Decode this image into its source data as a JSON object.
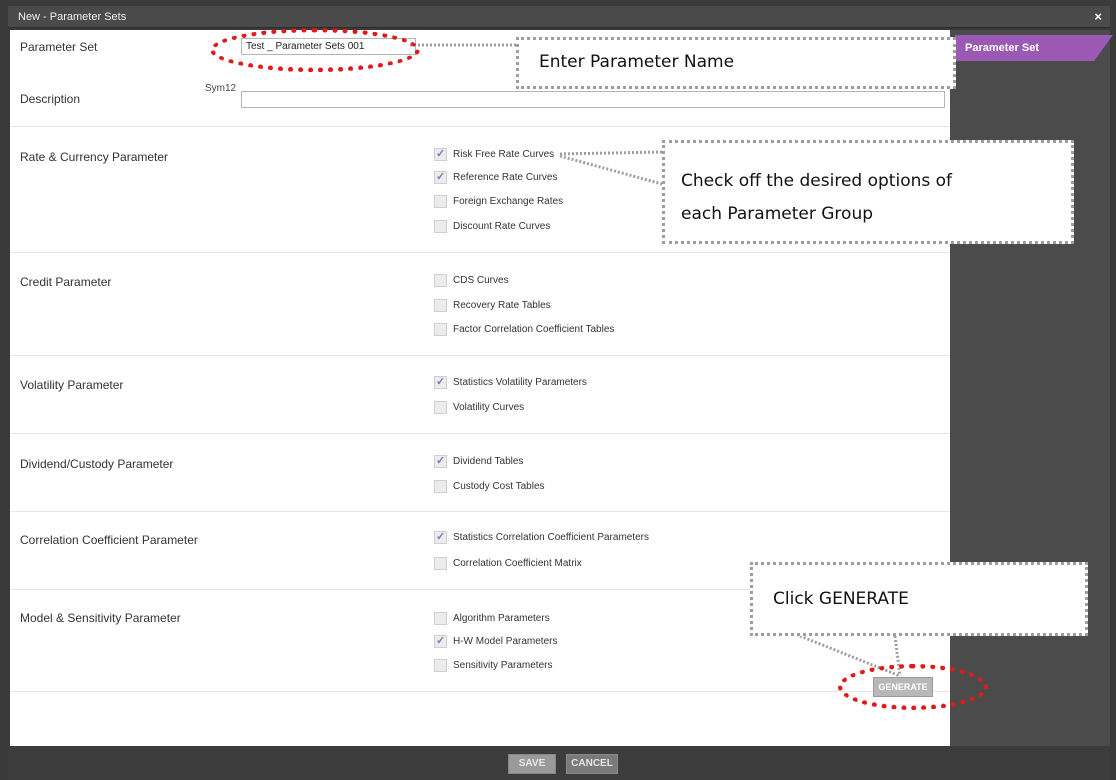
{
  "window": {
    "title": "New - Parameter Sets",
    "close_glyph": "×"
  },
  "side_tab": {
    "label": "Parameter Set",
    "color": "#9b59b6"
  },
  "form": {
    "parameter_set_label": "Parameter Set",
    "parameter_set_value": "Test _ Parameter Sets 001",
    "sym_hint": "Sym12",
    "description_label": "Description",
    "description_value": ""
  },
  "groups": [
    {
      "label": "Rate & Currency Parameter",
      "options": [
        {
          "label": "Risk Free Rate Curves",
          "checked": true
        },
        {
          "label": "Reference Rate Curves",
          "checked": true
        },
        {
          "label": "Foreign Exchange Rates",
          "checked": false
        },
        {
          "label": "Discount Rate Curves",
          "checked": false
        }
      ]
    },
    {
      "label": "Credit Parameter",
      "options": [
        {
          "label": "CDS Curves",
          "checked": false
        },
        {
          "label": "Recovery Rate Tables",
          "checked": false
        },
        {
          "label": "Factor Correlation Coefficient Tables",
          "checked": false
        }
      ]
    },
    {
      "label": "Volatility Parameter",
      "options": [
        {
          "label": "Statistics Volatility Parameters",
          "checked": true
        },
        {
          "label": "Volatility Curves",
          "checked": false
        }
      ]
    },
    {
      "label": "Dividend/Custody Parameter",
      "options": [
        {
          "label": "Dividend Tables",
          "checked": true
        },
        {
          "label": "Custody Cost Tables",
          "checked": false
        }
      ]
    },
    {
      "label": "Correlation Coefficient Parameter",
      "options": [
        {
          "label": "Statistics Correlation Coefficient Parameters",
          "checked": true
        },
        {
          "label": "Correlation Coefficient Matrix",
          "checked": false
        }
      ]
    },
    {
      "label": "Model & Sensitivity Parameter",
      "options": [
        {
          "label": "Algorithm Parameters",
          "checked": false
        },
        {
          "label": "H-W Model Parameters",
          "checked": true
        },
        {
          "label": "Sensitivity Parameters",
          "checked": false
        }
      ]
    }
  ],
  "buttons": {
    "generate": "GENERATE",
    "save": "SAVE",
    "cancel": "CANCEL"
  },
  "callouts": {
    "name": "Enter Parameter Name",
    "check_line1": "Check off the desired options of",
    "check_line2": "each Parameter Group",
    "generate": "Click GENERATE"
  }
}
